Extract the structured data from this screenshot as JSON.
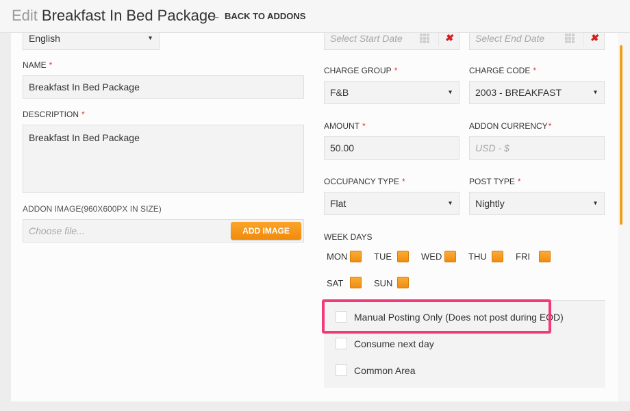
{
  "header": {
    "title_prefix": "Edit",
    "title": "Breakfast In Bed Package",
    "back_label": "BACK TO ADDONS"
  },
  "form": {
    "language": "English",
    "name_label": "NAME",
    "name_value": "Breakfast In Bed Package",
    "description_label": "DESCRIPTION",
    "description_value": "Breakfast In Bed Package",
    "image_label": "ADDON IMAGE(960X600PX IN SIZE)",
    "image_placeholder": "Choose file...",
    "add_image_label": "ADD IMAGE",
    "start_date_placeholder": "Select Start Date",
    "end_date_placeholder": "Select End Date",
    "charge_group_label": "CHARGE GROUP",
    "charge_group_value": "F&B",
    "charge_code_label": "CHARGE CODE",
    "charge_code_value": "2003 - BREAKFAST",
    "amount_label": "AMOUNT",
    "amount_value": "50.00",
    "currency_label": "ADDON CURRENCY",
    "currency_placeholder": "USD - $",
    "occupancy_label": "OCCUPANCY TYPE",
    "occupancy_value": "Flat",
    "post_type_label": "POST TYPE",
    "post_type_value": "Nightly",
    "week_days_label": "WEEK DAYS",
    "week_days": [
      "MON",
      "TUE",
      "WED",
      "THU",
      "FRI",
      "SAT",
      "SUN"
    ],
    "options": [
      "Manual Posting Only (Does not post during EOD)",
      "Consume next day",
      "Common Area"
    ]
  },
  "colors": {
    "accent_orange": "#f7941d",
    "required_red": "#e53030",
    "highlight_pink": "#f23a7a"
  }
}
